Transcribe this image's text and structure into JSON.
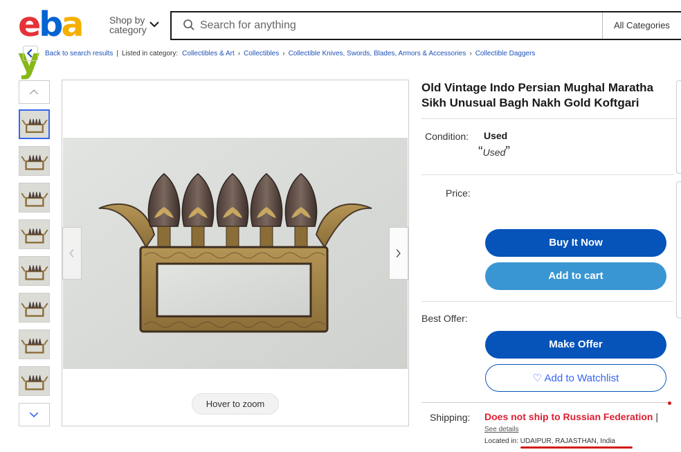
{
  "header": {
    "logo": {
      "letters": [
        {
          "char": "e",
          "color": "#e53238"
        },
        {
          "char": "b",
          "color": "#0064d2"
        },
        {
          "char": "a",
          "color": "#f5af02"
        },
        {
          "char": "y",
          "color": "#86b817"
        }
      ]
    },
    "shop_by_line1": "Shop by",
    "shop_by_line2": "category",
    "search_placeholder": "Search for anything",
    "category_select": "All Categories"
  },
  "breadcrumb": {
    "back": "Back to search results",
    "listed_in": "Listed in category:",
    "items": [
      "Collectibles & Art",
      "Collectibles",
      "Collectible Knives, Swords, Blades, Armors & Accessories",
      "Collectible Daggers"
    ]
  },
  "gallery": {
    "thumbnail_count": 8,
    "active_index": 0,
    "hover_zoom": "Hover to zoom"
  },
  "item": {
    "title": "Old Vintage Indo Persian Mughal Maratha Sikh Unusual Bagh Nakh Gold Koftgari",
    "condition_label": "Condition:",
    "condition_value": "Used",
    "condition_quote": "Used",
    "price_label": "Price:",
    "buy_now": "Buy It Now",
    "add_to_cart": "Add to cart",
    "best_offer_label": "Best Offer:",
    "make_offer": "Make Offer",
    "add_to_watchlist": "Add to Watchlist",
    "shipping_label": "Shipping:",
    "shipping_value": "Does not ship to Russian Federation",
    "shipping_sep": "|",
    "see_details": "See details",
    "located_label": "Located in:",
    "located_value": "UDAIPUR, RAJASTHAN, India"
  },
  "colors": {
    "primary_button": "#0654ba",
    "secondary_button": "#3a96d2",
    "link": "#1d51b8",
    "warning_red": "#dd1e31"
  }
}
